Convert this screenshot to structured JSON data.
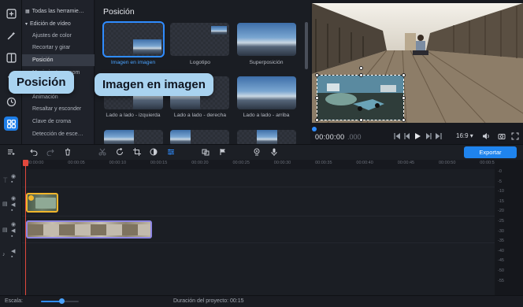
{
  "categories": [
    {
      "label": "Todas las herramie…",
      "type": "top",
      "icon": "grid-icon"
    },
    {
      "label": "Edición de vídeo",
      "type": "top",
      "icon": "chevron-down-icon"
    },
    {
      "label": "Ajustes de color",
      "type": "item"
    },
    {
      "label": "Recortar y girar",
      "type": "item"
    },
    {
      "label": "Posición",
      "type": "item",
      "selected": true
    },
    {
      "label": "Movimiento y zoom",
      "type": "item"
    },
    {
      "label": "Animación",
      "type": "item"
    },
    {
      "label": "Resaltar y esconder",
      "type": "item"
    },
    {
      "label": "Clave de croma",
      "type": "item"
    },
    {
      "label": "Detección de esce…",
      "type": "item"
    }
  ],
  "panel": {
    "title": "Posición",
    "tiles": [
      {
        "label": "Imagen en imagen",
        "selected": true
      },
      {
        "label": "Logotipo"
      },
      {
        "label": "Superposición"
      },
      {
        "label": "Lado a lado - izquierda"
      },
      {
        "label": "Lado a lado - derecha"
      },
      {
        "label": "Lado a lado - arriba"
      }
    ]
  },
  "tooltips": {
    "position": "Posición",
    "pip": "Imagen en imagen"
  },
  "player": {
    "timecode": "00:00:00",
    "timecode_ms": ".000",
    "aspect": "16:9 ▾"
  },
  "toolbar": {
    "export_label": "Exportar"
  },
  "ruler": {
    "ticks": [
      "00:00:00",
      "00:00:05",
      "00:00:10",
      "00:00:15",
      "00:00:20",
      "00:00:25",
      "00:00:30",
      "00:00:35",
      "00:00:40",
      "00:00:45",
      "00:00:50",
      "00:00:55",
      "00:01:0"
    ]
  },
  "meter": {
    "labels": [
      "-0",
      "-5",
      "-10",
      "-15",
      "-20",
      "-25",
      "-30",
      "-35",
      "-40",
      "-45",
      "-50",
      "-55"
    ]
  },
  "status": {
    "scale_label": "Escala:",
    "scale_level": 0.55,
    "duration": "Duración del proyecto:  00:15"
  },
  "colors": {
    "accent": "#1f84ee",
    "playhead": "#e2483d",
    "overlay_clip": "#f0b62c",
    "main_clip": "#8e86e3",
    "tooltip": "#a9d3f0"
  }
}
